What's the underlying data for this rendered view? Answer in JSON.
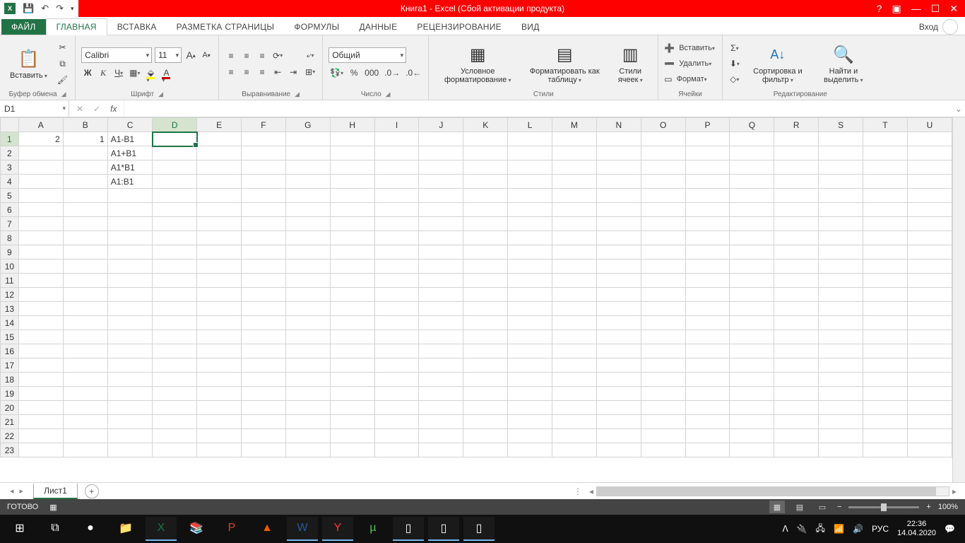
{
  "title": "Книга1 -  Excel (Сбой активации продукта)",
  "tabs": {
    "file": "ФАЙЛ",
    "list": [
      "ГЛАВНАЯ",
      "ВСТАВКА",
      "РАЗМЕТКА СТРАНИЦЫ",
      "ФОРМУЛЫ",
      "ДАННЫЕ",
      "РЕЦЕНЗИРОВАНИЕ",
      "ВИД"
    ],
    "active": "ГЛАВНАЯ",
    "signin": "Вход"
  },
  "ribbon": {
    "clipboard": {
      "label": "Буфер обмена",
      "paste": "Вставить"
    },
    "font": {
      "label": "Шрифт",
      "name": "Calibri",
      "size": "11",
      "bold": "Ж",
      "italic": "К",
      "underline": "Ч",
      "incr": "A",
      "decr": "A"
    },
    "align": {
      "label": "Выравнивание"
    },
    "number": {
      "label": "Число",
      "format": "Общий"
    },
    "styles": {
      "label": "Стили",
      "cond": "Условное форматирование",
      "tbl": "Форматировать как таблицу",
      "cell": "Стили ячеек"
    },
    "cells": {
      "label": "Ячейки",
      "insert": "Вставить",
      "delete": "Удалить",
      "format": "Формат"
    },
    "editing": {
      "label": "Редактирование",
      "sort": "Сортировка и фильтр",
      "find": "Найти и выделить"
    }
  },
  "namebox": "D1",
  "formula": "",
  "columns": [
    "A",
    "B",
    "C",
    "D",
    "E",
    "F",
    "G",
    "H",
    "I",
    "J",
    "K",
    "L",
    "M",
    "N",
    "O",
    "P",
    "Q",
    "R",
    "S",
    "T",
    "U"
  ],
  "rows": 23,
  "active_cell": {
    "col": "D",
    "row": 1
  },
  "cells": {
    "A1": "2",
    "B1": "1",
    "C1": "A1-B1",
    "C2": "A1+B1",
    "C3": "A1*B1",
    "C4": "A1:B1"
  },
  "numeric_cells": [
    "A1",
    "B1"
  ],
  "sheet_tab": "Лист1",
  "status": {
    "ready": "ГОТОВО",
    "zoom": "100%"
  },
  "tray": {
    "lang": "РУС",
    "time": "22:36",
    "date": "14.04.2020"
  }
}
